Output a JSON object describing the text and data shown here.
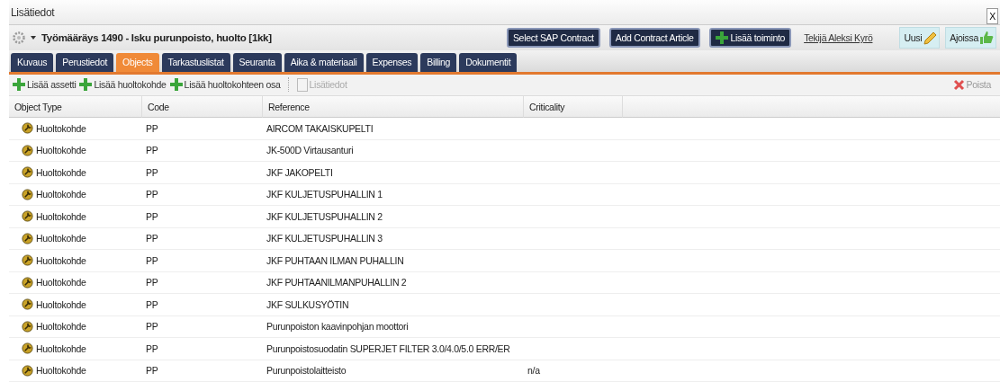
{
  "window": {
    "title": "Lisätiedot",
    "close": "X"
  },
  "header": {
    "title": "Työmääräys 1490 - Isku purunpoisto, huolto [1kk]",
    "buttons": [
      {
        "label": "Select SAP Contract",
        "kind": "plain"
      },
      {
        "label": "Add Contract Article",
        "kind": "plain"
      },
      {
        "label": "Lisää toiminto",
        "kind": "add"
      }
    ],
    "author_link": "Tekijä Aleksi Kyrö",
    "badges": [
      {
        "label": "Uusi",
        "kind": "pencil"
      },
      {
        "label": "Ajoissa",
        "kind": "thumb"
      }
    ]
  },
  "tabs": [
    {
      "label": "Kuvaus",
      "selected": false
    },
    {
      "label": "Perustiedot",
      "selected": false
    },
    {
      "label": "Objects",
      "selected": true
    },
    {
      "label": "Tarkastuslistat",
      "selected": false
    },
    {
      "label": "Seuranta",
      "selected": false
    },
    {
      "label": "Aika & materiaali",
      "selected": false
    },
    {
      "label": "Expenses",
      "selected": false
    },
    {
      "label": "Billing",
      "selected": false
    },
    {
      "label": "Dokumentit",
      "selected": false
    }
  ],
  "toolbar": {
    "actions": [
      {
        "label": "Lisää assetti",
        "disabled": false
      },
      {
        "label": "Lisää huoltokohde",
        "disabled": false
      },
      {
        "label": "Lisää huoltokohteen osa",
        "disabled": false
      },
      {
        "label": "Lisätiedot",
        "disabled": true
      }
    ],
    "delete": "Poista"
  },
  "table": {
    "columns": [
      "Object Type",
      "Code",
      "Reference",
      "Criticality"
    ],
    "rows": [
      [
        "Huoltokohde",
        "PP",
        "AIRCOM TAKAISKUPELTI",
        ""
      ],
      [
        "Huoltokohde",
        "PP",
        "JK-500D Virtausanturi",
        ""
      ],
      [
        "Huoltokohde",
        "PP",
        "JKF JAKOPELTI",
        ""
      ],
      [
        "Huoltokohde",
        "PP",
        "JKF KULJETUSPUHALLIN 1",
        ""
      ],
      [
        "Huoltokohde",
        "PP",
        "JKF KULJETUSPUHALLIN 2",
        ""
      ],
      [
        "Huoltokohde",
        "PP",
        "JKF KULJETUSPUHALLIN 3",
        ""
      ],
      [
        "Huoltokohde",
        "PP",
        "JKF PUHTAAN ILMAN PUHALLIN",
        ""
      ],
      [
        "Huoltokohde",
        "PP",
        "JKF PUHTAANILMANPUHALLIN 2",
        ""
      ],
      [
        "Huoltokohde",
        "PP",
        "JKF SULKUSYÖTIN",
        ""
      ],
      [
        "Huoltokohde",
        "PP",
        "Purunpoiston kaavinpohjan moottori",
        ""
      ],
      [
        "Huoltokohde",
        "PP",
        "Purunpoistosuodatin SUPERJET FILTER 3.0/4.0/5.0 ERR/ER",
        ""
      ],
      [
        "Huoltokohde",
        "PP",
        "Purunpoistolaitteisto",
        "n/a"
      ]
    ]
  }
}
